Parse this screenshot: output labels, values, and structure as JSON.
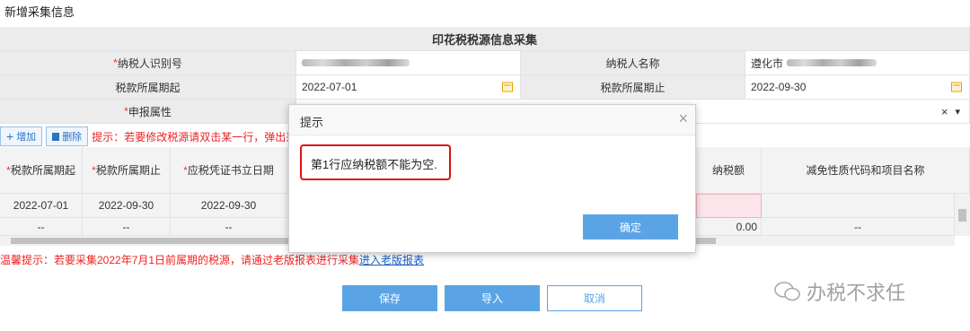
{
  "page": {
    "title": "新增采集信息"
  },
  "form": {
    "header": "印花税税源信息采集",
    "taxpayer_id_label": "纳税人识别号",
    "taxpayer_name_label": "纳税人名称",
    "taxpayer_name_prefix": "遵化市",
    "period_start_label": "税款所属期起",
    "period_start_value": "2022-07-01",
    "period_end_label": "税款所属期止",
    "period_end_value": "2022-09-30",
    "declare_attr_label": "申报属性",
    "clear_symbol": "×",
    "dropdown_symbol": "▾"
  },
  "toolbar": {
    "add_label": "增加",
    "delete_label": "删除",
    "hint": "提示：若要修改税源请双击某一行，弹出采"
  },
  "grid": {
    "columns": {
      "period_start": "税款所属期起",
      "period_end": "税款所属期止",
      "voucher_date": "应税凭证书立日期",
      "tax_payable": "纳税额",
      "exemption": "减免性质代码和项目名称"
    },
    "rows": [
      {
        "period_start": "2022-07-01",
        "period_end": "2022-09-30",
        "voucher_date": "2022-09-30",
        "tax_payable": "",
        "exemption": ""
      },
      {
        "period_start": "--",
        "period_end": "--",
        "voucher_date": "--",
        "tax_payable": "0.00",
        "exemption": "--"
      }
    ]
  },
  "warm_tip": {
    "text": "温馨提示：若要采集2022年7月1日前属期的税源，请通过老版报表进行采集",
    "link": "进入老版报表"
  },
  "buttons": {
    "save": "保存",
    "import": "导入",
    "cancel": "取消"
  },
  "dialog": {
    "title": "提示",
    "close": "×",
    "message": "第1行应纳税额不能为空.",
    "confirm": "确定"
  },
  "watermark": {
    "text": "办税不求任"
  },
  "colors": {
    "primary": "#5aa4e6",
    "danger": "#e22222",
    "highlight_border": "#e01010",
    "error_cell": "#fbe5ea"
  }
}
